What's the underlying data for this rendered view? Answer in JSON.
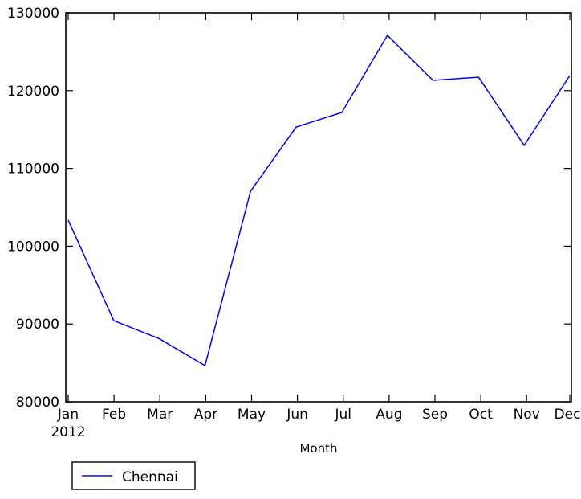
{
  "chart_data": {
    "type": "line",
    "title": "",
    "xlabel": "Month",
    "ylabel": "",
    "categories": [
      "Jan",
      "Feb",
      "Mar",
      "Apr",
      "May",
      "Jun",
      "Jul",
      "Aug",
      "Sep",
      "Oct",
      "Nov",
      "Dec"
    ],
    "x_sublabel": "2012",
    "series": [
      {
        "name": "Chennai",
        "color": "#0000ff",
        "values": [
          103350,
          90430,
          88100,
          84650,
          107070,
          115330,
          117190,
          127110,
          121320,
          121730,
          112960,
          121940
        ]
      }
    ],
    "ylim": [
      80000,
      130000
    ],
    "ytick_labels": [
      "80000",
      "90000",
      "100000",
      "110000",
      "120000",
      "130000"
    ],
    "ytick_values": [
      80000,
      90000,
      100000,
      110000,
      120000,
      130000
    ],
    "grid": false,
    "legend_position": "below-left",
    "legend_entries": [
      {
        "label": "Chennai",
        "color": "#0000ff"
      }
    ]
  },
  "axes": {
    "y_tick_0": "80000",
    "y_tick_1": "90000",
    "y_tick_2": "100000",
    "y_tick_3": "110000",
    "y_tick_4": "120000",
    "y_tick_5": "130000",
    "x_tick_0": "Jan",
    "x_tick_1": "Feb",
    "x_tick_2": "Mar",
    "x_tick_3": "Apr",
    "x_tick_4": "May",
    "x_tick_5": "Jun",
    "x_tick_6": "Jul",
    "x_tick_7": "Aug",
    "x_tick_8": "Sep",
    "x_tick_9": "Oct",
    "x_tick_10": "Nov",
    "x_tick_11": "Dec",
    "x_year": "2012",
    "xlabel": "Month"
  },
  "legend": {
    "entry_0_label": "Chennai"
  }
}
